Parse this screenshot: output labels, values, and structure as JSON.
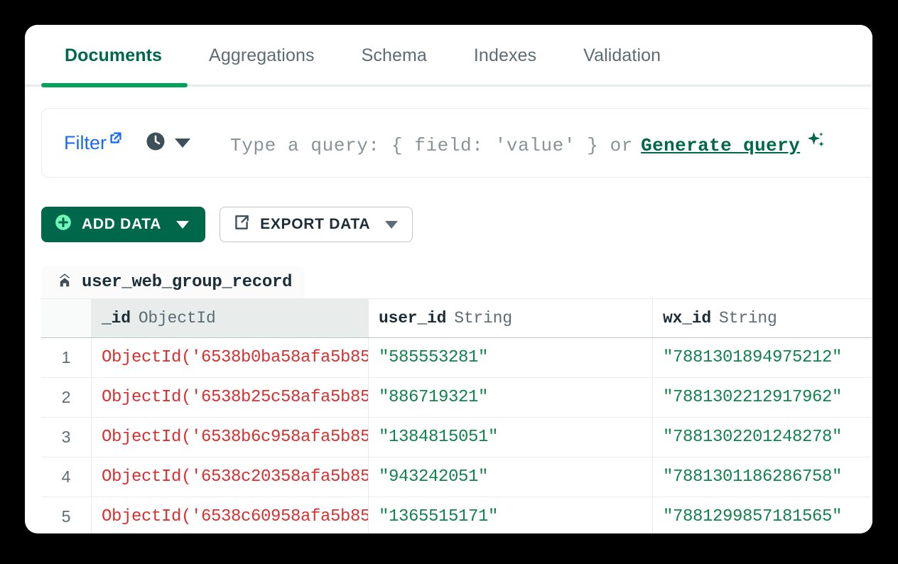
{
  "tabs": [
    {
      "label": "Documents",
      "active": true
    },
    {
      "label": "Aggregations",
      "active": false
    },
    {
      "label": "Schema",
      "active": false
    },
    {
      "label": "Indexes",
      "active": false
    },
    {
      "label": "Validation",
      "active": false
    }
  ],
  "filter_bar": {
    "label": "Filter",
    "external_link_icon": "external-link-icon",
    "history_icon": "clock-icon",
    "history_caret_icon": "chevron-down-icon",
    "query_placeholder": "Type a query: { field: 'value' } or",
    "generate_query_label": "Generate query",
    "sparkle_icon": "sparkle-icon"
  },
  "actions": {
    "add_data": {
      "label": "ADD DATA",
      "icon": "plus-circle-icon",
      "caret": "chevron-down-icon",
      "bg_color": "#00684A",
      "text_color": "#FFFFFF"
    },
    "export_data": {
      "label": "EXPORT DATA",
      "icon": "export-icon",
      "caret": "chevron-down-icon",
      "bg_color": "#FFFFFF",
      "text_color": "#1C2D38"
    }
  },
  "collection": {
    "home_icon": "home-icon",
    "name": "user_web_group_record"
  },
  "table": {
    "columns": [
      {
        "name": "_id",
        "type": "ObjectId",
        "highlighted": true
      },
      {
        "name": "user_id",
        "type": "String",
        "highlighted": false
      },
      {
        "name": "wx_id",
        "type": "String",
        "highlighted": false
      }
    ],
    "rows": [
      {
        "number": "1",
        "_id": "ObjectId('6538b0ba58afa5b85…",
        "user_id": "\"585553281\"",
        "wx_id": "\"7881301894975212\""
      },
      {
        "number": "2",
        "_id": "ObjectId('6538b25c58afa5b85…",
        "user_id": "\"886719321\"",
        "wx_id": "\"7881302212917962\""
      },
      {
        "number": "3",
        "_id": "ObjectId('6538b6c958afa5b85…",
        "user_id": "\"1384815051\"",
        "wx_id": "\"7881302201248278\""
      },
      {
        "number": "4",
        "_id": "ObjectId('6538c20358afa5b85…",
        "user_id": "\"943242051\"",
        "wx_id": "\"7881301186286758\""
      },
      {
        "number": "5",
        "_id": "ObjectId('6538c60958afa5b85…",
        "user_id": "\"1365515171\"",
        "wx_id": "\"7881299857181565\""
      }
    ]
  },
  "colors": {
    "brand_green": "#00684A",
    "accent_green": "#00A35C",
    "link_blue": "#1B6BEF",
    "objectid_red": "#DB3030",
    "string_green": "#12824D"
  }
}
